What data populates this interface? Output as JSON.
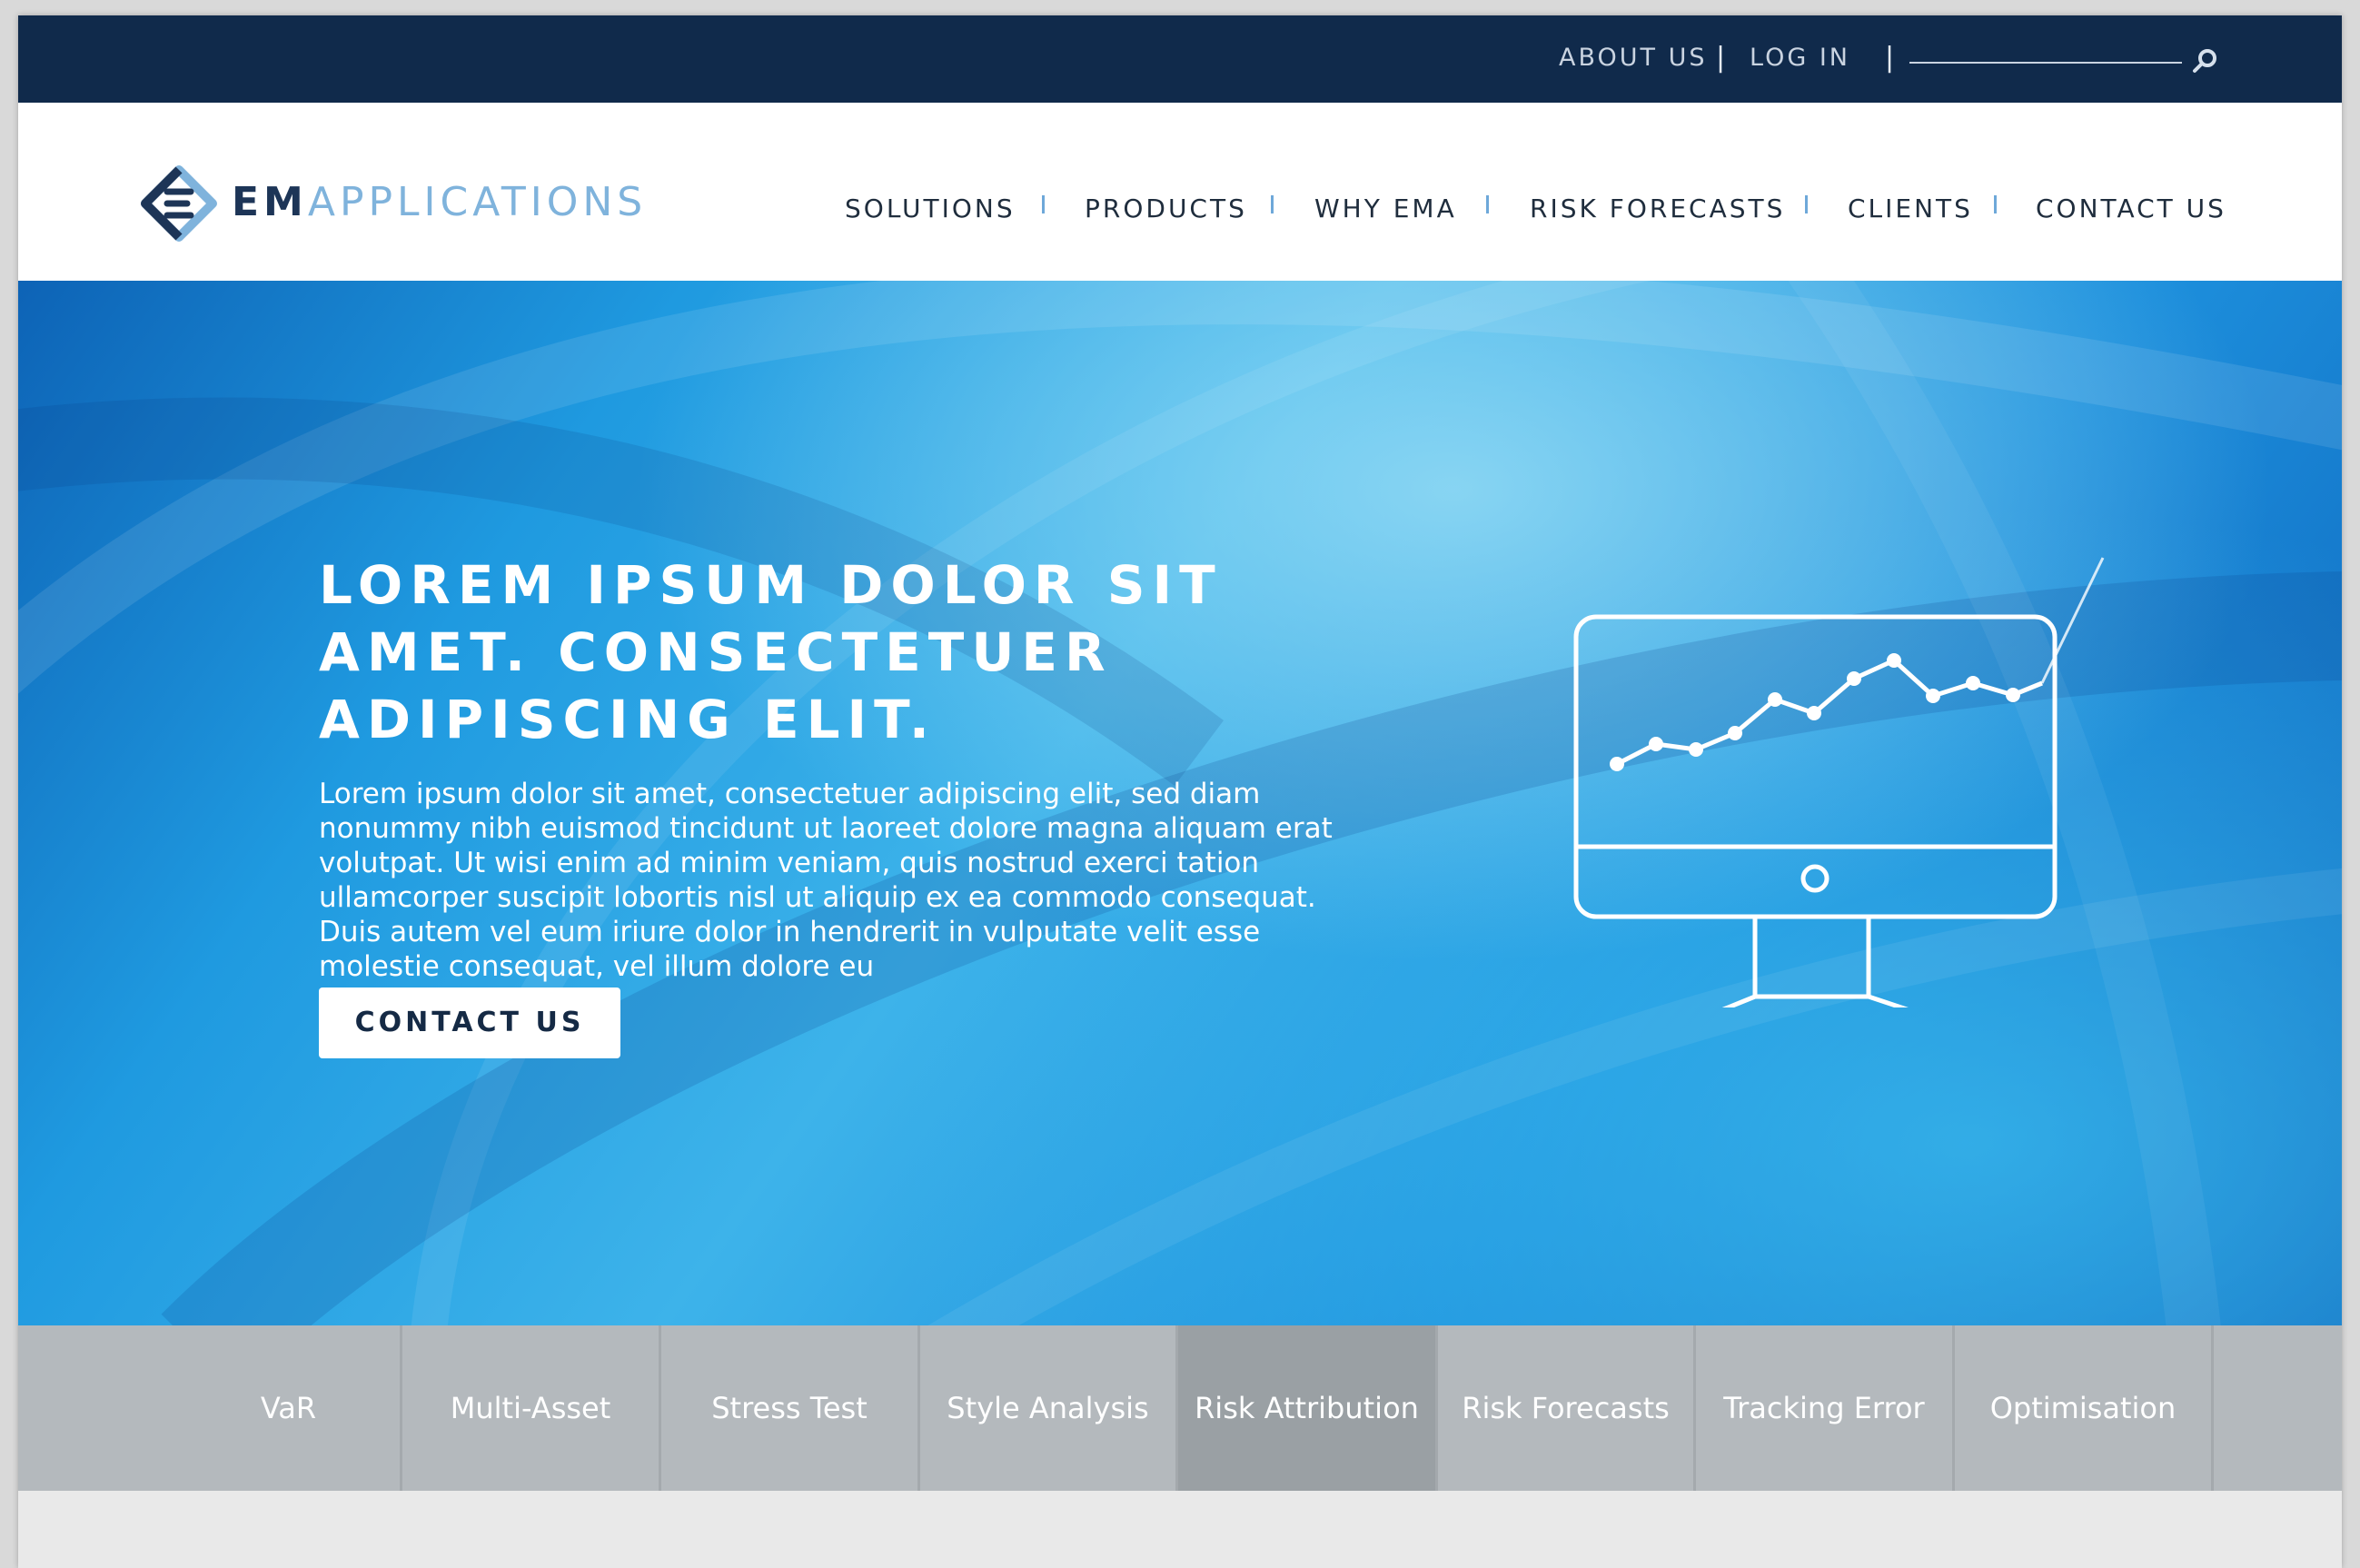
{
  "topbar": {
    "about_label": "ABOUT US",
    "login_label": "LOG IN",
    "separator": "|",
    "search_placeholder": "",
    "search_icon": "search-icon"
  },
  "brand": {
    "logo_icon": "ema-logo-icon",
    "name_bold": "EM",
    "name_light": "APPLICATIONS",
    "primary_color": "#1d3557",
    "secondary_color": "#7fb3dc"
  },
  "nav": {
    "items": [
      {
        "label": "SOLUTIONS"
      },
      {
        "label": "PRODUCTS"
      },
      {
        "label": "WHY EMA"
      },
      {
        "label": "RISK FORECASTS"
      },
      {
        "label": "CLIENTS"
      },
      {
        "label": "CONTACT US"
      }
    ],
    "separator_color": "#6ea8d9"
  },
  "hero": {
    "title_lines": [
      "LOREM IPSUM DOLOR SIT",
      "AMET. CONSECTETUER",
      "ADIPISCING ELIT."
    ],
    "body": "Lorem ipsum dolor sit amet, consectetuer adipiscing elit, sed diam nonummy nibh euismod tincidunt ut laoreet dolore magna aliquam erat volutpat. Ut wisi enim ad minim veniam, quis nostrud exerci tation ullamcorper suscipit lobortis nisl ut aliquip ex ea commodo consequat. Duis autem vel eum iriure dolor in hendrerit in vulputate velit esse molestie consequat, vel illum dolore eu",
    "cta_label": "CONTACT US",
    "illustration_icon": "monitor-chart-icon"
  },
  "tabs": {
    "items": [
      {
        "label": "VaR",
        "active": false
      },
      {
        "label": "Multi-Asset",
        "active": false
      },
      {
        "label": "Stress Test",
        "active": false
      },
      {
        "label": "Style Analysis",
        "active": false
      },
      {
        "label": "Risk Attribution",
        "active": true
      },
      {
        "label": "Risk Forecasts",
        "active": false
      },
      {
        "label": "Tracking Error",
        "active": false
      },
      {
        "label": "Optimisation",
        "active": false
      }
    ],
    "background_color": "#b4b9bd",
    "active_color": "#9aa0a4"
  },
  "colors": {
    "topbar": "#102a4b",
    "header": "#ffffff",
    "hero_accent": "#1f9ae0"
  }
}
